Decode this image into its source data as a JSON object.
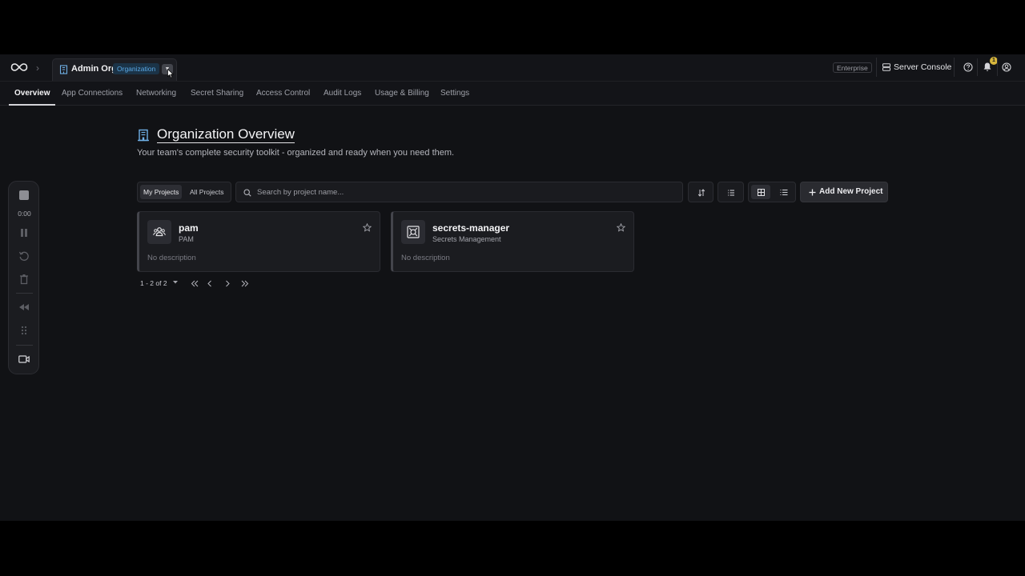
{
  "topbar": {
    "org_name": "Admin Org",
    "org_badge": "Organization",
    "plan_badge": "Enterprise",
    "server_console_label": "Server Console",
    "notification_count": "1"
  },
  "nav": {
    "tabs": [
      {
        "label": "Overview",
        "active": true
      },
      {
        "label": "App Connections"
      },
      {
        "label": "Networking"
      },
      {
        "label": "Secret Sharing"
      },
      {
        "label": "Access Control"
      },
      {
        "label": "Audit Logs"
      },
      {
        "label": "Usage & Billing"
      },
      {
        "label": "Settings"
      }
    ]
  },
  "page": {
    "title": "Organization Overview",
    "subtitle": "Your team's complete security toolkit - organized and ready when you need them."
  },
  "toolbar": {
    "my_projects": "My Projects",
    "all_projects": "All Projects",
    "search_placeholder": "Search by project name...",
    "add_label": "Add New Project"
  },
  "projects": [
    {
      "name": "pam",
      "type": "PAM",
      "description": "No description",
      "icon": "users-icon"
    },
    {
      "name": "secrets-manager",
      "type": "Secrets Management",
      "description": "No description",
      "icon": "vault-icon"
    }
  ],
  "pagination": {
    "range": "1 - 2 of 2"
  },
  "recorder": {
    "time": "0:00"
  },
  "colors": {
    "background": "#111215",
    "accent_blue": "#5aa9e6",
    "notification_badge": "#d7b63c"
  }
}
